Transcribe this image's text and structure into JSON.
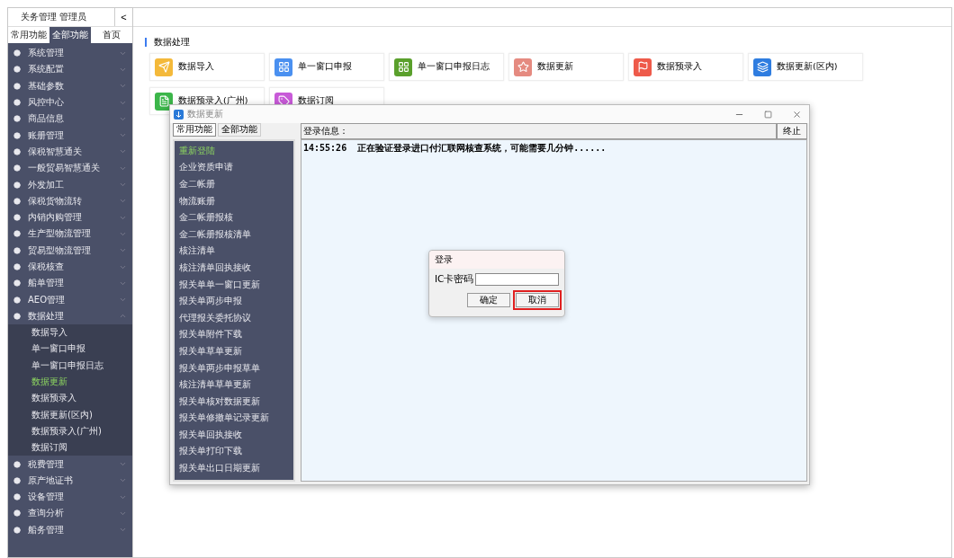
{
  "sidebar": {
    "title": "关务管理 管理员",
    "collapse": "<",
    "tabs": [
      {
        "label": "常用功能",
        "selected": false
      },
      {
        "label": "全部功能",
        "selected": true
      },
      {
        "label": "首页",
        "selected": false
      }
    ],
    "items": [
      {
        "label": "系统管理",
        "expanded": false
      },
      {
        "label": "系统配置",
        "expanded": false
      },
      {
        "label": "基础参数",
        "expanded": false
      },
      {
        "label": "风控中心",
        "expanded": false
      },
      {
        "label": "商品信息",
        "expanded": false
      },
      {
        "label": "账册管理",
        "expanded": false
      },
      {
        "label": "保税智慧通关",
        "expanded": false
      },
      {
        "label": "一般贸易智慧通关",
        "expanded": false
      },
      {
        "label": "外发加工",
        "expanded": false
      },
      {
        "label": "保税货物流转",
        "expanded": false
      },
      {
        "label": "内销内购管理",
        "expanded": false
      },
      {
        "label": "生产型物流管理",
        "expanded": false
      },
      {
        "label": "贸易型物流管理",
        "expanded": false
      },
      {
        "label": "保税核查",
        "expanded": false
      },
      {
        "label": "船单管理",
        "expanded": false
      },
      {
        "label": "AEO管理",
        "expanded": false
      },
      {
        "label": "数据处理",
        "expanded": true,
        "children": [
          {
            "label": "数据导入",
            "selected": false
          },
          {
            "label": "单一窗口申报",
            "selected": false
          },
          {
            "label": "单一窗口申报日志",
            "selected": false
          },
          {
            "label": "数据更新",
            "selected": true
          },
          {
            "label": "数据预录入",
            "selected": false
          },
          {
            "label": "数据更新(区内)",
            "selected": false
          },
          {
            "label": "数据预录入(广州)",
            "selected": false
          },
          {
            "label": "数据订阅",
            "selected": false
          }
        ]
      },
      {
        "label": "税费管理",
        "expanded": false
      },
      {
        "label": "原产地证书",
        "expanded": false
      },
      {
        "label": "设备管理",
        "expanded": false
      },
      {
        "label": "查询分析",
        "expanded": false
      },
      {
        "label": "船务管理",
        "expanded": false
      }
    ]
  },
  "main": {
    "section_title": "数据处理",
    "tiles": [
      {
        "label": "数据导入",
        "color": "#f4b93a"
      },
      {
        "label": "单一窗口申报",
        "color": "#4a90f0"
      },
      {
        "label": "单一窗口申报日志",
        "color": "#5aa02c"
      },
      {
        "label": "数据更新",
        "color": "#e58a80"
      },
      {
        "label": "数据预录入",
        "color": "#ee5a4a"
      },
      {
        "label": "数据更新(区内)",
        "color": "#2f7de0"
      },
      {
        "label": "数据预录入(广州)",
        "color": "#3cb64a"
      },
      {
        "label": "数据订阅",
        "color": "#c85ad8"
      }
    ]
  },
  "window": {
    "title": "数据更新",
    "tabs": [
      {
        "label": "常用功能",
        "selected": true
      },
      {
        "label": "全部功能",
        "selected": false
      }
    ],
    "functions": [
      {
        "label": "重新登陆",
        "selected": true
      },
      {
        "label": "企业资质申请",
        "selected": false
      },
      {
        "label": "金二帐册",
        "selected": false
      },
      {
        "label": "物流账册",
        "selected": false
      },
      {
        "label": "金二帐册报核",
        "selected": false
      },
      {
        "label": "金二帐册报核清单",
        "selected": false
      },
      {
        "label": "核注清单",
        "selected": false
      },
      {
        "label": "核注清单回执接收",
        "selected": false
      },
      {
        "label": "报关单单一窗口更新",
        "selected": false
      },
      {
        "label": "报关单两步申报",
        "selected": false
      },
      {
        "label": "代理报关委托协议",
        "selected": false
      },
      {
        "label": "报关单附件下载",
        "selected": false
      },
      {
        "label": "报关单草单更新",
        "selected": false
      },
      {
        "label": "报关单两步申报草单",
        "selected": false
      },
      {
        "label": "核注清单草单更新",
        "selected": false
      },
      {
        "label": "报关单核对数据更新",
        "selected": false
      },
      {
        "label": "报关单修撤单记录更新",
        "selected": false
      },
      {
        "label": "报关单回执接收",
        "selected": false
      },
      {
        "label": "报关单打印下载",
        "selected": false
      },
      {
        "label": "报关单出口日期更新",
        "selected": false
      }
    ],
    "log_label": "登录信息：",
    "stop_button": "终止",
    "log_lines": [
      "14:55:26  正在验证登录进口付汇联网核查系统，可能需要几分钟......"
    ],
    "login_dialog": {
      "title": "登录",
      "field_label": "IC卡密码",
      "ok": "确定",
      "cancel": "取消"
    }
  }
}
